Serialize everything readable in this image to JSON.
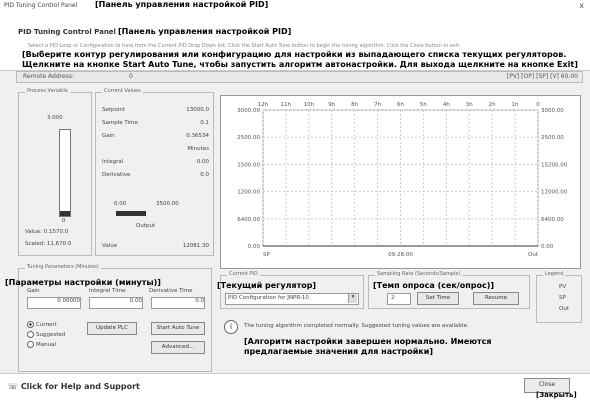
{
  "window": {
    "title": "PID Tuning Control Panel",
    "title_ru": "[Панель управления настройкой PID]",
    "close_glyph": "x"
  },
  "header": {
    "title": "PID Tuning Control Panel",
    "title_ru": "[Панель управления настройкой PID]",
    "subtitle": "Select a PID Loop or Configuration to tune from the Current PID Drop Down list. Click the Start Auto Tune button to begin the tuning algorithm. Click the Close button to exit.",
    "instructions_ru": "[Выберите контур регулирования или конфигурацию для настройки из выпадающего списка текущих регуляторов. Щелкните на кнопке Start Auto Tune, чтобы запустить алгоритм автонастройки. Для выхода щелкните на кнопке Exit]"
  },
  "address_bar": {
    "label": "Remote Address:",
    "value": "0",
    "right": "[PV] [OP] [SP] [V] 60.00"
  },
  "process_variable": {
    "label": "Process Variable",
    "top_value": "3.000",
    "zero": "0",
    "value_label": "Value: 0.1570.0",
    "scaled_label": "Scaled: 11,670.0",
    "fill_fraction": 0.06
  },
  "current_values": {
    "label": "Current Values",
    "rows": [
      {
        "name": "Setpoint",
        "value": "13000.0"
      },
      {
        "name": "Sample Time",
        "value": "0.1"
      },
      {
        "name": "Gain",
        "value": "0.36534"
      },
      {
        "name": "",
        "value": "Minutes"
      },
      {
        "name": "Integral",
        "value": "0.00"
      },
      {
        "name": "Derivative",
        "value": "0.0"
      }
    ],
    "output_min": "0.00",
    "output_max": "3500.00",
    "output_label": "Output",
    "value_label": "Value",
    "value": "12081.30",
    "output_fraction": 0.45
  },
  "chart_data": {
    "type": "line",
    "x_ticks": [
      "12h",
      "11h",
      "10h",
      "9h",
      "8h",
      "7h",
      "6h",
      "5h",
      "4h",
      "3h",
      "2h",
      "1h",
      "0"
    ],
    "y_ticks": [
      "3000.00",
      "2500.00",
      "1500.00",
      "1200.00",
      "6400.00",
      "0.00"
    ],
    "y_ticks_right": [
      "3000.00",
      "2500.00",
      "15200.00",
      "12000.00",
      "6400.00",
      "0.00"
    ],
    "x_bottom_labels": [
      "SP",
      "09:28:00",
      "Out"
    ],
    "grid": true,
    "series": [
      {
        "values": [
          0,
          0,
          0,
          0,
          0,
          0,
          0,
          0,
          0,
          0,
          0,
          0,
          0
        ]
      }
    ]
  },
  "tuning_params": {
    "label": "Tuning Parameters (Minutes)",
    "label_ru": "[Параметры настройки (минуты)]",
    "col1": "Gain",
    "col2": "Integral Time",
    "col3": "Derivative Time",
    "values": [
      "0.00000",
      "0.00",
      "0.0"
    ],
    "radios": [
      {
        "label": "Current",
        "selected": true
      },
      {
        "label": "Suggested",
        "selected": false
      },
      {
        "label": "Manual",
        "selected": false
      }
    ],
    "update_button": "Update PLC",
    "start_button": "Start Auto Tune",
    "advanced_button": "Advanced..."
  },
  "current_pid": {
    "label": "Current PID",
    "label_ru": "[Текущий регулятор]",
    "value": "PID Configuration for JNPR-10"
  },
  "sampling": {
    "label": "Sampling Rate (Seconds/Sample)",
    "label_ru": "[Темп опроса (сек/опрос)]",
    "value": "2",
    "set_button": "Set Time",
    "resume_button": "Resume"
  },
  "legend": {
    "label": "Legend",
    "items": [
      "PV",
      "SP",
      "Out"
    ]
  },
  "status": {
    "text": "The tuning algorithm completed normally. Suggested tuning values are available.",
    "text_ru": "[Алгоритм настройки завершен нормально. Имеются предлагаемые значения для настройки]"
  },
  "footer": {
    "help": "Click for Help and Support",
    "close": "Close",
    "close_ru": "[Закрыть]"
  }
}
